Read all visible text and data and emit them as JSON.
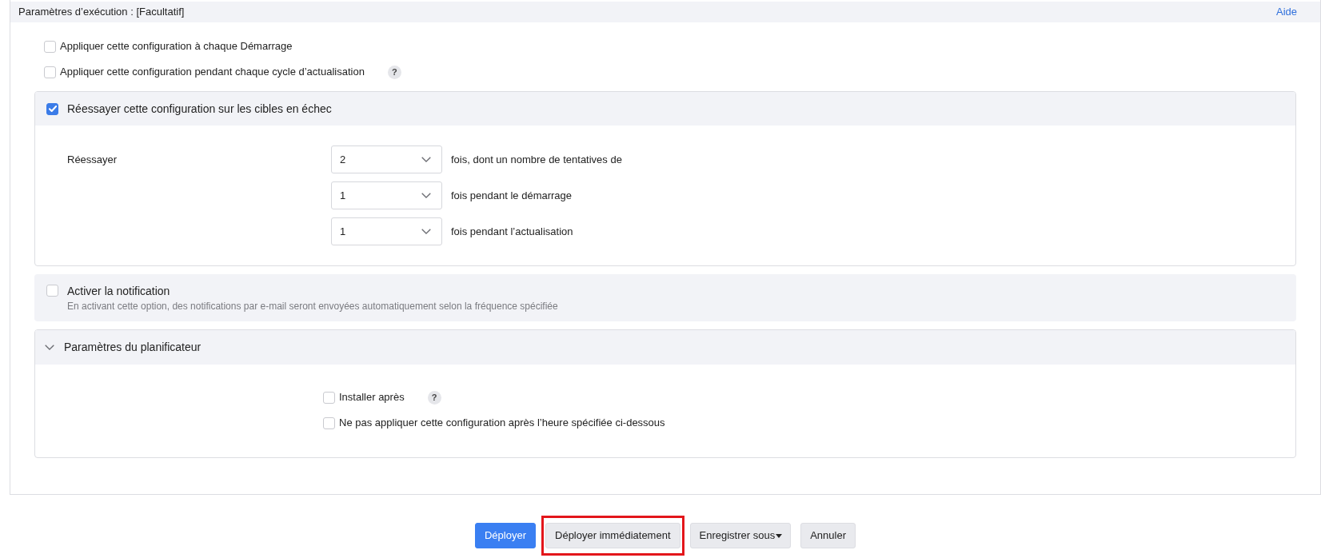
{
  "panel": {
    "title": "Paramètres d’exécution : [Facultatif]",
    "help_link": "Aide"
  },
  "options": [
    {
      "label": "Appliquer cette configuration à chaque Démarrage",
      "checked": false
    },
    {
      "label": "Appliquer cette configuration pendant chaque cycle d’actualisation",
      "checked": false,
      "help_badge": "?"
    }
  ],
  "retry": {
    "label": "Réessayer cette configuration sur les cibles en échec",
    "checked": true,
    "row_label": "Réessayer",
    "fields": [
      {
        "value": "2",
        "suffix": "fois, dont un nombre de tentatives de"
      },
      {
        "value": "1",
        "suffix": "fois pendant le démarrage"
      },
      {
        "value": "1",
        "suffix": "fois pendant l’actualisation"
      }
    ]
  },
  "notification": {
    "label": "Activer la notification",
    "checked": false,
    "description": "En activant cette option, des notifications par e-mail seront envoyées automatiquement selon la fréquence spécifiée"
  },
  "scheduler": {
    "title": "Paramètres du planificateur",
    "expanded": true,
    "options": [
      {
        "label": "Installer après",
        "checked": false,
        "help_badge": "?"
      },
      {
        "label": "Ne pas appliquer cette configuration après l’heure spécifiée ci-dessous",
        "checked": false
      }
    ]
  },
  "buttons": [
    {
      "label": "Déployer",
      "kind": "primary",
      "highlighted": false
    },
    {
      "label": "Déployer immédiatement",
      "kind": "secondary",
      "highlighted": true
    },
    {
      "label": "Enregistrer sous",
      "kind": "dropdown",
      "highlighted": false
    },
    {
      "label": "Annuler",
      "kind": "secondary",
      "highlighted": false
    }
  ]
}
